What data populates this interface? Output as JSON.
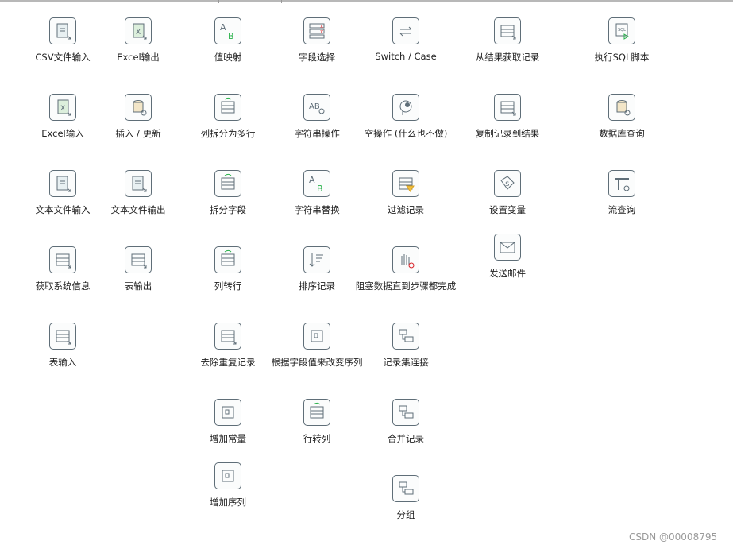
{
  "canvas": {
    "steps": [
      {
        "label": "CSV文件输入",
        "icon": "csv-file-input-icon"
      },
      {
        "label": "Excel输出",
        "icon": "excel-output-icon"
      },
      {
        "label": "值映射",
        "icon": "value-mapper-icon"
      },
      {
        "label": "字段选择",
        "icon": "select-values-icon"
      },
      {
        "label": "Switch / Case",
        "icon": "switch-case-icon"
      },
      {
        "label": "从结果获取记录",
        "icon": "get-rows-from-result-icon"
      },
      {
        "label": "执行SQL脚本",
        "icon": "execute-sql-icon"
      },
      {
        "label": "Excel输入",
        "icon": "excel-input-icon"
      },
      {
        "label": "插入 / 更新",
        "icon": "insert-update-icon"
      },
      {
        "label": "列拆分为多行",
        "icon": "split-field-to-rows-icon"
      },
      {
        "label": "字符串操作",
        "icon": "string-operations-icon"
      },
      {
        "label": "空操作 (什么也不做)",
        "icon": "dummy-icon"
      },
      {
        "label": "复制记录到结果",
        "icon": "copy-rows-to-result-icon"
      },
      {
        "label": "数据库查询",
        "icon": "database-lookup-icon"
      },
      {
        "label": "文本文件输入",
        "icon": "text-file-input-icon"
      },
      {
        "label": "文本文件输出",
        "icon": "text-file-output-icon"
      },
      {
        "label": "拆分字段",
        "icon": "split-fields-icon"
      },
      {
        "label": "字符串替换",
        "icon": "replace-string-icon"
      },
      {
        "label": "过滤记录",
        "icon": "filter-rows-icon"
      },
      {
        "label": "设置变量",
        "icon": "set-variables-icon"
      },
      {
        "label": "流查询",
        "icon": "stream-lookup-icon"
      },
      {
        "label": "获取系统信息",
        "icon": "system-info-icon"
      },
      {
        "label": "表输出",
        "icon": "table-output-icon"
      },
      {
        "label": "列转行",
        "icon": "normaliser-icon"
      },
      {
        "label": "排序记录",
        "icon": "sort-rows-icon"
      },
      {
        "label": "阻塞数据直到步骤都完成",
        "icon": "blocking-step-icon"
      },
      {
        "label": "发送邮件",
        "icon": "mail-icon"
      },
      {
        "label": "表输入",
        "icon": "table-input-icon"
      },
      {
        "label": "去除重复记录",
        "icon": "unique-rows-icon"
      },
      {
        "label": "根据字段值来改变序列",
        "icon": "add-value-fields-changing-sequence-icon"
      },
      {
        "label": "记录集连接",
        "icon": "merge-join-icon"
      },
      {
        "label": "增加常量",
        "icon": "add-constants-icon"
      },
      {
        "label": "行转列",
        "icon": "denormaliser-icon"
      },
      {
        "label": "合并记录",
        "icon": "merge-rows-icon"
      },
      {
        "label": "增加序列",
        "icon": "add-sequence-icon"
      },
      {
        "label": "分组",
        "icon": "group-by-icon"
      }
    ]
  },
  "watermark": "CSDN @00008795",
  "colors": {
    "icon_border": "#5f6e78",
    "accent_green": "#2bb24c",
    "accent_red": "#d9262c",
    "accent_yellow": "#f0c040"
  }
}
